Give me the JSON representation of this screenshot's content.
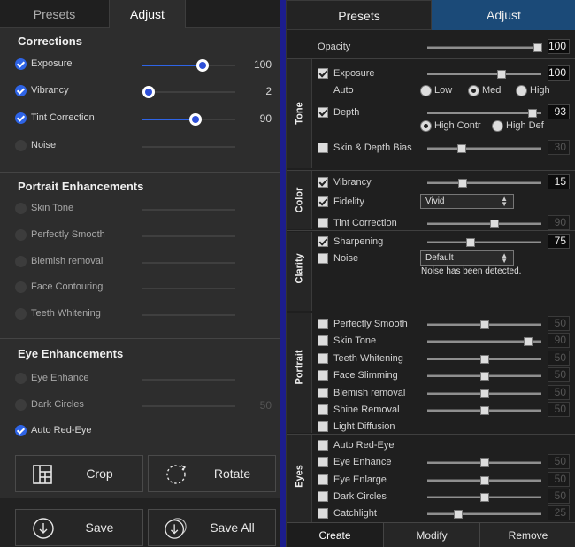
{
  "left": {
    "tabs": [
      "Presets",
      "Adjust"
    ],
    "active_tab": "Adjust",
    "corrections": {
      "title": "Corrections",
      "items": [
        {
          "label": "Exposure",
          "checked": true,
          "value": "100",
          "level": 0.65
        },
        {
          "label": "Vibrancy",
          "checked": true,
          "value": "2",
          "level": 0.08
        },
        {
          "label": "Tint Correction",
          "checked": true,
          "value": "90",
          "level": 0.58
        },
        {
          "label": "Noise",
          "checked": false
        }
      ]
    },
    "portrait": {
      "title": "Portrait Enhancements",
      "items": [
        "Skin Tone",
        "Perfectly Smooth",
        "Blemish removal",
        "Face Contouring",
        "Teeth Whitening"
      ]
    },
    "eye": {
      "title": "Eye Enhancements",
      "items": [
        {
          "label": "Eye Enhance",
          "checked": false
        },
        {
          "label": "Dark Circles",
          "checked": false,
          "value": "50"
        },
        {
          "label": "Auto Red-Eye",
          "checked": true
        }
      ]
    },
    "buttons": {
      "crop": "Crop",
      "rotate": "Rotate",
      "save": "Save",
      "save_all": "Save All"
    }
  },
  "right": {
    "tabs": [
      "Presets",
      "Adjust"
    ],
    "active_tab": "Adjust",
    "opacity": {
      "label": "Opacity",
      "value": "100",
      "level": 1.0
    },
    "tone": {
      "group_label": "Tone",
      "exposure": {
        "label": "Exposure",
        "checked": true,
        "value": "100",
        "level": 0.65
      },
      "auto": {
        "label": "Auto",
        "options": [
          "Low",
          "Med",
          "High"
        ],
        "selected": "Med"
      },
      "depth": {
        "label": "Depth",
        "checked": true,
        "value": "93",
        "level": 0.92
      },
      "depth_mode": {
        "options": [
          "High Contr",
          "High Def"
        ],
        "selected": "High Contr"
      },
      "skin_depth_bias": {
        "label": "Skin & Depth Bias",
        "checked": false,
        "value": "30",
        "level": 0.3
      }
    },
    "color": {
      "group_label": "Color",
      "vibrancy": {
        "label": "Vibrancy",
        "checked": true,
        "value": "15",
        "level": 0.31
      },
      "fidelity": {
        "label": "Fidelity",
        "checked": true,
        "dropdown": "Vivid"
      },
      "tint_correction": {
        "label": "Tint Correction",
        "checked": false,
        "value": "90",
        "level": 0.59
      }
    },
    "clarity": {
      "group_label": "Clarity",
      "sharpening": {
        "label": "Sharpening",
        "checked": true,
        "value": "75",
        "level": 0.38
      },
      "noise": {
        "label": "Noise",
        "checked": false,
        "dropdown": "Default",
        "note": "Noise has been detected."
      }
    },
    "portrait": {
      "group_label": "Portrait",
      "items": [
        {
          "label": "Perfectly Smooth",
          "checked": false,
          "value": "50",
          "level": 0.5
        },
        {
          "label": "Skin Tone",
          "checked": false,
          "value": "90",
          "level": 0.88
        },
        {
          "label": "Teeth Whitening",
          "checked": false,
          "value": "50",
          "level": 0.5
        },
        {
          "label": "Face Slimming",
          "checked": false,
          "value": "50",
          "level": 0.5
        },
        {
          "label": "Blemish removal",
          "checked": false,
          "value": "50",
          "level": 0.5
        },
        {
          "label": "Shine Removal",
          "checked": false,
          "value": "50",
          "level": 0.5
        },
        {
          "label": "Light Diffusion",
          "checked": false
        }
      ]
    },
    "eyes": {
      "group_label": "Eyes",
      "items": [
        {
          "label": "Auto Red-Eye",
          "checked": false
        },
        {
          "label": "Eye Enhance",
          "checked": false,
          "value": "50",
          "level": 0.5
        },
        {
          "label": "Eye Enlarge",
          "checked": false,
          "value": "50",
          "level": 0.5
        },
        {
          "label": "Dark Circles",
          "checked": false,
          "value": "50",
          "level": 0.5
        },
        {
          "label": "Catchlight",
          "checked": false,
          "value": "25",
          "level": 0.27
        }
      ]
    },
    "bottom_tabs": [
      "Create",
      "Modify",
      "Remove"
    ]
  }
}
